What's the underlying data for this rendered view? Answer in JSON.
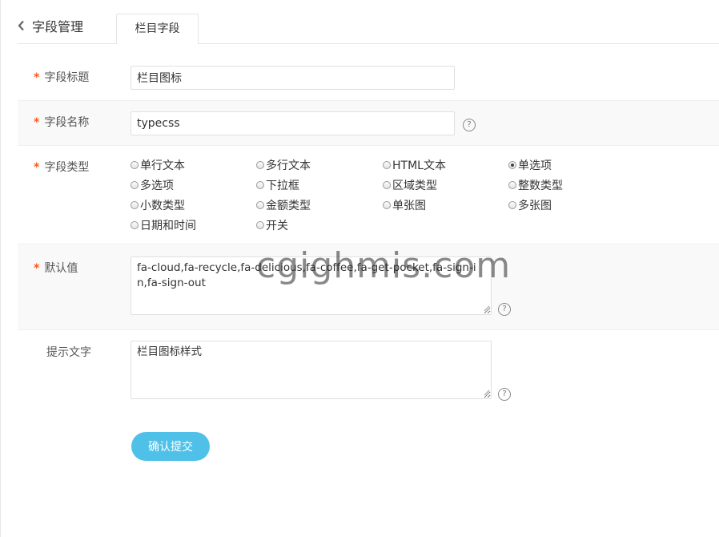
{
  "header": {
    "back_label": "字段管理",
    "tab_label": "栏目字段"
  },
  "form": {
    "title_field": {
      "label": "字段标题",
      "required": "*",
      "value": "栏目图标"
    },
    "name_field": {
      "label": "字段名称",
      "required": "*",
      "value": "typecss",
      "help": "?"
    },
    "type_field": {
      "label": "字段类型",
      "required": "*",
      "options": [
        "单行文本",
        "多行文本",
        "HTML文本",
        "单选项",
        "多选项",
        "下拉框",
        "区域类型",
        "整数类型",
        "小数类型",
        "金额类型",
        "单张图",
        "多张图",
        "日期和时间",
        "开关"
      ],
      "selected": "单选项"
    },
    "default_field": {
      "label": "默认值",
      "required": "*",
      "value": "fa-cloud,fa-recycle,fa-delicious,fa-coffee,fa-get-pocket,fa-sign-in,fa-sign-out",
      "help": "?"
    },
    "hint_field": {
      "label": "提示文字",
      "value": "栏目图标样式",
      "help": "?"
    },
    "submit_label": "确认提交"
  },
  "watermark": "cgighmis.com",
  "colors": {
    "accent": "#4fc1e9",
    "required": "#ff5722"
  }
}
